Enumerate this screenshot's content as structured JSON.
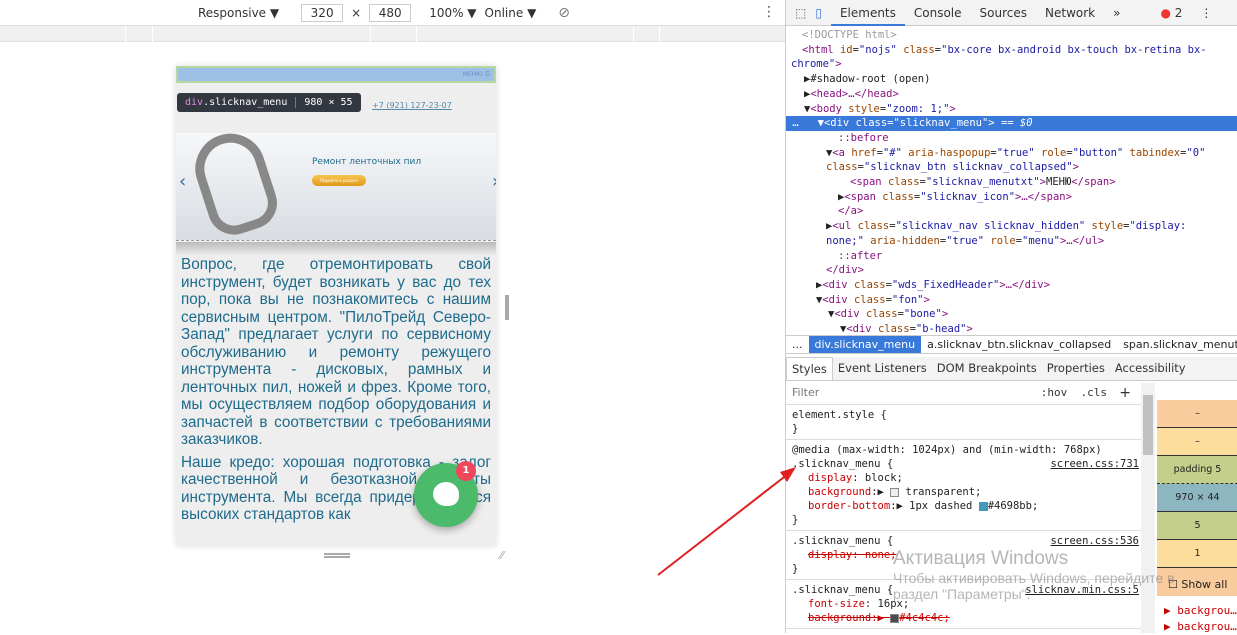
{
  "device_toolbar": {
    "device": "Responsive ▼",
    "width": "320",
    "height": "480",
    "x": "×",
    "zoom": "100% ▼",
    "network": "Online ▼",
    "rotate_icon": "rotate-icon",
    "more": "⋮"
  },
  "page": {
    "menu_label": "МЕНЮ ☰",
    "tooltip": {
      "tag": "div",
      "cls": ".slicknav_menu",
      "size": "980 × 55"
    },
    "phone": "+7 (921) 127-23-07",
    "slider": {
      "title": "Ремонт ленточных пил",
      "button": "Перейти в раздел",
      "prev": "‹",
      "next": "›"
    },
    "paragraphs": [
      "Вопрос, где отремонтировать свой инструмент, будет возникать у вас до тех пор, пока вы не познакомитесь с нашим сервисным центром. \"ПилоТрейд Северо-Запад\" предлагает услуги по сервисному обслуживанию и ремонту режущего инструмента - дисковых, рамных и ленточных пил, ножей и фрез. Кроме того, мы осуществляем подбор оборудования и запчастей в соответствии с требованиями заказчиков.",
      "Наше кредо: хорошая подготовка - залог качественной и безотказной работы инструмента. Мы всегда придерживаемся высоких стандартов как"
    ],
    "chat_badge": "1"
  },
  "devtools": {
    "tabs": [
      "Elements",
      "Console",
      "Sources",
      "Network",
      "»"
    ],
    "errors": "2",
    "breadcrumb": [
      "...",
      "div.slicknav_menu",
      "a.slicknav_btn.slicknav_collapsed",
      "span.slicknav_menutxt"
    ],
    "subtabs": [
      "Styles",
      "Event Listeners",
      "DOM Breakpoints",
      "Properties",
      "Accessibility"
    ],
    "filter_placeholder": "Filter",
    "hov": ":hov",
    "cls": ".cls",
    "plus": "+",
    "box_model": [
      "–",
      "–",
      "padding 5",
      "970 × 44",
      "5",
      "1",
      "–"
    ],
    "show_all": "Show all",
    "computed": [
      "backgrou…",
      "backgrou…"
    ],
    "watermark": {
      "title": "Активация Windows",
      "line1": "Чтобы активировать Windows, перейдите в",
      "line2": "раздел \"Параметры\"."
    }
  },
  "colors": {
    "accent": "#3879d9",
    "text_link": "#1e6b8c",
    "chat": "#4cba6b",
    "badge": "#f0475a",
    "border_color": "#4698bb"
  }
}
